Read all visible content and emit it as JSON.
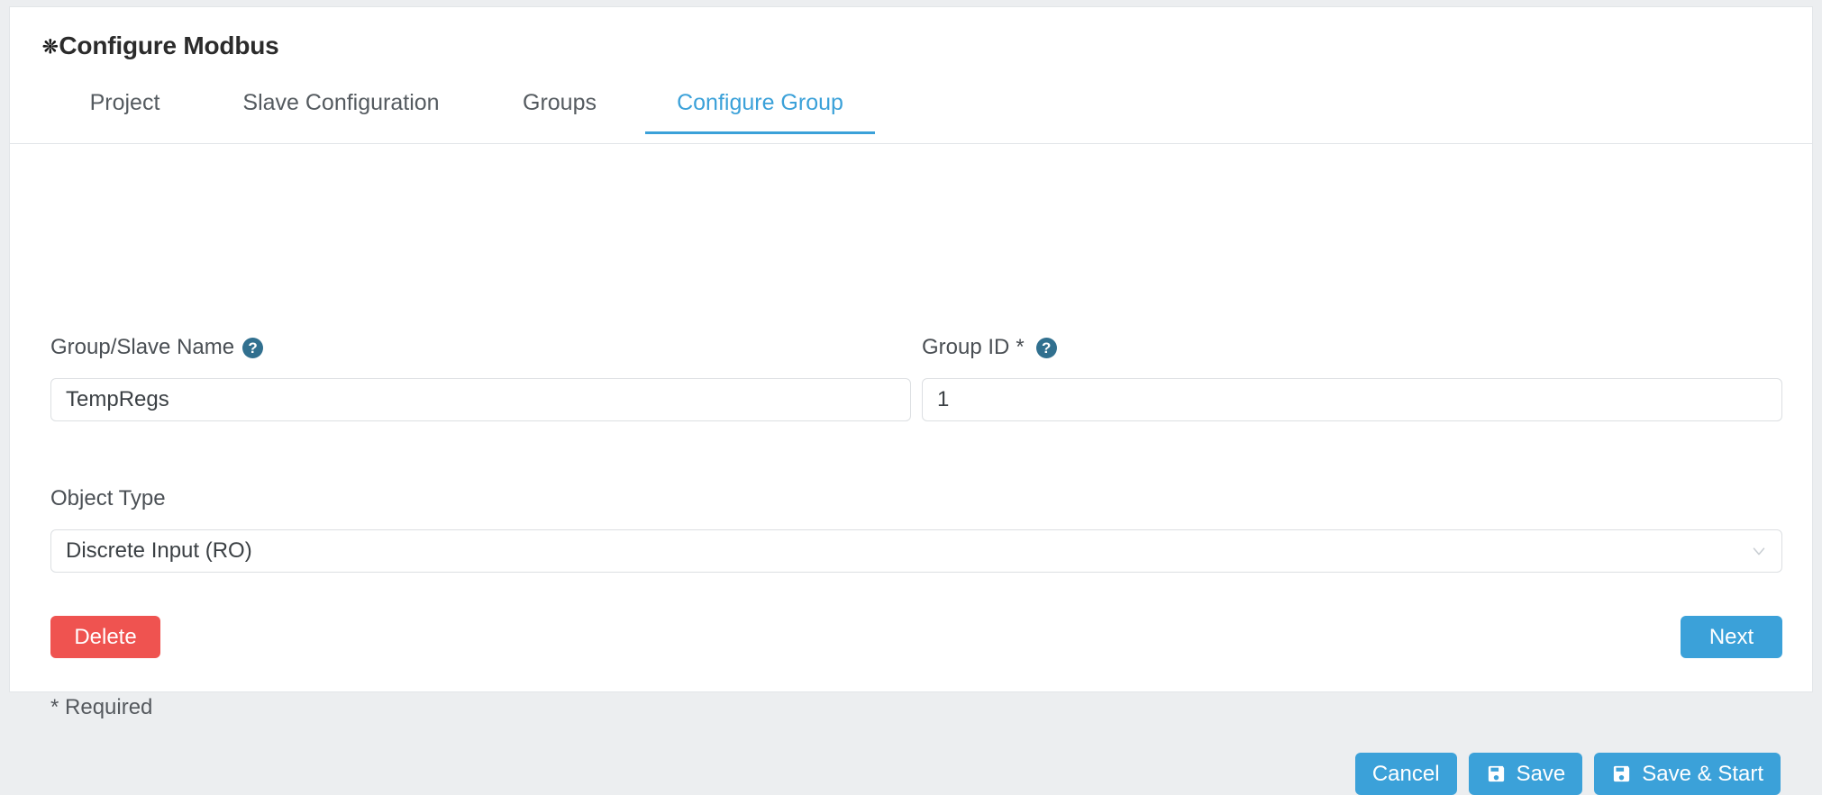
{
  "window": {
    "title": "Configure Modbus",
    "title_icon": "asterisk-icon"
  },
  "tabs": [
    {
      "label": "Project",
      "active": false
    },
    {
      "label": "Slave Configuration",
      "active": false
    },
    {
      "label": "Groups",
      "active": false
    },
    {
      "label": "Configure Group",
      "active": true
    }
  ],
  "form": {
    "group_name": {
      "label": "Group/Slave Name",
      "help_icon": "question-mark-icon",
      "value": "TempRegs",
      "placeholder": ""
    },
    "group_id": {
      "label": "Group ID",
      "required_marker": "*",
      "help_icon": "question-mark-icon",
      "value": "1",
      "placeholder": ""
    },
    "object_type": {
      "label": "Object Type",
      "value": "Discrete Input (RO)",
      "chevron_icon": "chevron-down-icon"
    }
  },
  "actions": {
    "delete": "Delete",
    "next": "Next",
    "cancel": "Cancel",
    "save": "Save",
    "save_and_start": "Save & Start",
    "save_icon": "floppy-disk-icon"
  },
  "notes": {
    "required": "* Required"
  },
  "colors": {
    "accent": "#3ba1d9",
    "danger": "#ef5350",
    "help": "#31708f",
    "page_bg": "#eceef0",
    "card_bg": "#ffffff",
    "border": "#e2e5e8",
    "text": "#4a4f54"
  }
}
